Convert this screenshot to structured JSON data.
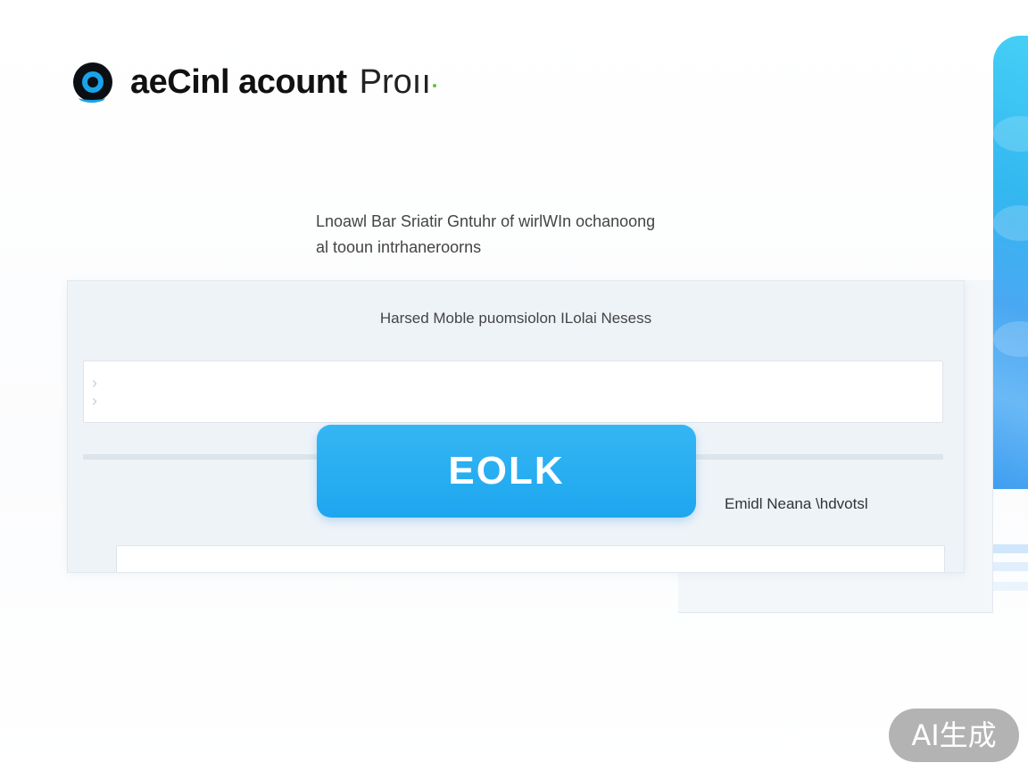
{
  "brand": {
    "title": "aeCinl acount",
    "subtitle": "Proıı",
    "accent_color": "#1aa3e8",
    "logo_icon": "eye-logo-icon"
  },
  "intro": {
    "line1": "Lnoawl Bar Sriatir  Gntuhr of wirlWIn ochanoong",
    "line2": "al tooun intrhaneroorns"
  },
  "form": {
    "mobile_label": "Harsed Moble puomsiolon ILolai  Nesess",
    "mobile_value": "",
    "mobile_placeholder": "",
    "email_label": "Emidl Neana \\hdvotsl",
    "email_value": "",
    "email_placeholder": ""
  },
  "primary_button": {
    "label": "EOLK",
    "color": "#1da6ef"
  },
  "watermark": {
    "label": "AI生成"
  }
}
